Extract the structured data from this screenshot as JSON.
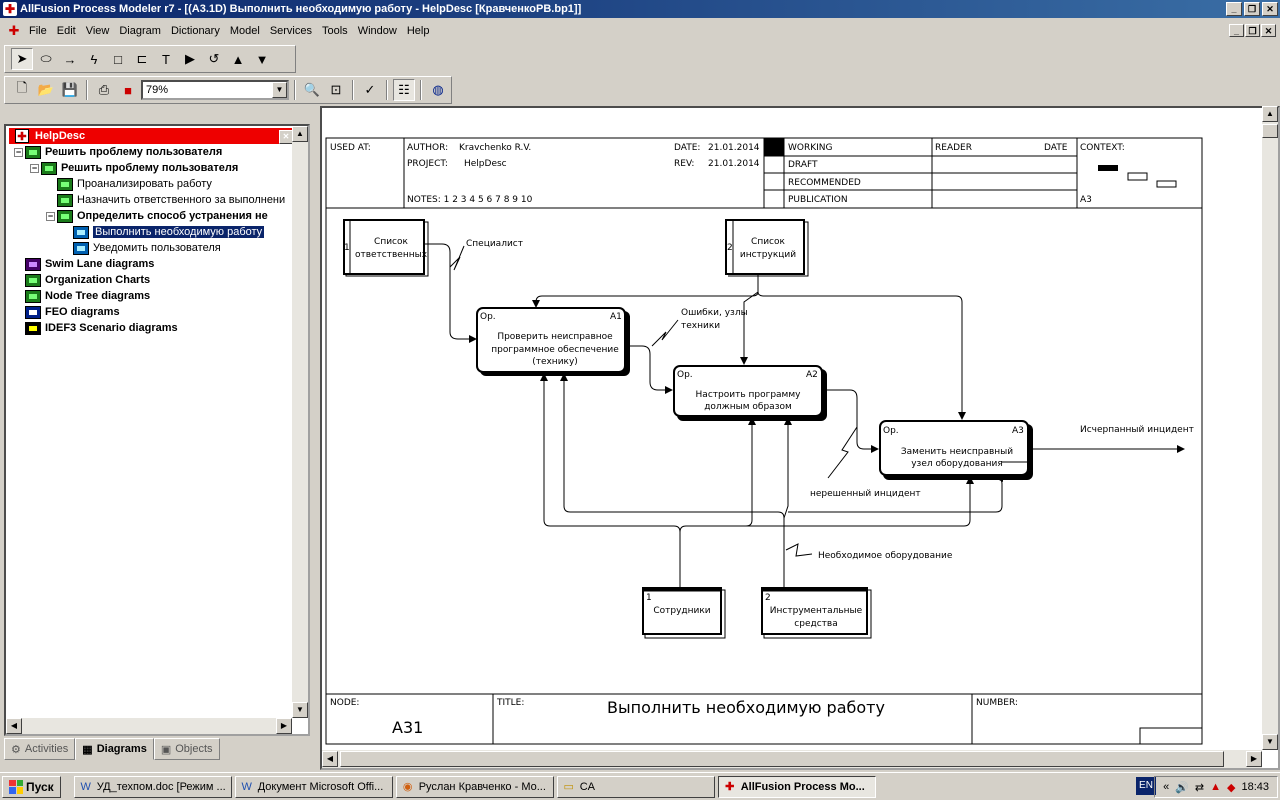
{
  "window": {
    "title": "AllFusion Process Modeler r7 - [(A3.1D) Выполнить необходимую работу - HelpDesc  [КравченкоРВ.bp1]]"
  },
  "menu": [
    "File",
    "Edit",
    "View",
    "Diagram",
    "Dictionary",
    "Model",
    "Services",
    "Tools",
    "Window",
    "Help"
  ],
  "toolbar": {
    "zoom": "79%"
  },
  "tree": {
    "root": "HelpDesc",
    "nodes": [
      {
        "label": "Решить проблему пользователя",
        "level": 0,
        "bold": true,
        "expanded": true,
        "icon": "green"
      },
      {
        "label": "Решить проблему пользователя",
        "level": 1,
        "bold": true,
        "expanded": true,
        "icon": "green"
      },
      {
        "label": "Проанализировать работу",
        "level": 2,
        "bold": false,
        "icon": "green"
      },
      {
        "label": "Назначить ответственного за выполнени",
        "level": 2,
        "bold": false,
        "icon": "green"
      },
      {
        "label": "Определить способ устранения не",
        "level": 2,
        "bold": true,
        "expanded": true,
        "icon": "green"
      },
      {
        "label": "Выполнить необходимую работу",
        "level": 3,
        "bold": false,
        "selected": true,
        "icon": "blue"
      },
      {
        "label": "Уведомить пользователя",
        "level": 3,
        "bold": false,
        "icon": "blue"
      },
      {
        "label": "Swim Lane diagrams",
        "level": 0,
        "bold": true,
        "icon": "swim"
      },
      {
        "label": "Organization Charts",
        "level": 0,
        "bold": true,
        "icon": "green"
      },
      {
        "label": "Node Tree diagrams",
        "level": 0,
        "bold": true,
        "icon": "green"
      },
      {
        "label": "FEO diagrams",
        "level": 0,
        "bold": true,
        "icon": "feo"
      },
      {
        "label": "IDEF3 Scenario diagrams",
        "level": 0,
        "bold": true,
        "icon": "idef3"
      }
    ]
  },
  "tabs": [
    {
      "label": "Activities",
      "active": false
    },
    {
      "label": "Diagrams",
      "active": true
    },
    {
      "label": "Objects",
      "active": false
    }
  ],
  "header": {
    "used_at": "USED AT:",
    "author_label": "AUTHOR:",
    "author": "Kravchenko R.V.",
    "project_label": "PROJECT:",
    "project": "HelpDesc",
    "date_label": "DATE:",
    "date": "21.01.2014",
    "rev_label": "REV:",
    "rev": "21.01.2014",
    "notes": "NOTES:  1  2  3  4  5  6  7  8  9  10",
    "status": [
      "WORKING",
      "DRAFT",
      "RECOMMENDED",
      "PUBLICATION"
    ],
    "reader": "READER",
    "reader_date": "DATE",
    "context": "CONTEXT:",
    "context_node": "A3"
  },
  "footer": {
    "node_label": "NODE:",
    "node": "A31",
    "title_label": "TITLE:",
    "title": "Выполнить необходимую работу",
    "number_label": "NUMBER:"
  },
  "diagram": {
    "activities": [
      {
        "code": "A1",
        "op": "Op.",
        "lines": [
          "Проверить неисправное",
          "программное обеспечение",
          "(технику)"
        ]
      },
      {
        "code": "A2",
        "op": "Op.",
        "lines": [
          "Настроить программу",
          "должным образом"
        ]
      },
      {
        "code": "A3",
        "op": "Op.",
        "lines": [
          "Заменить неисправный",
          "узел оборудования"
        ]
      }
    ],
    "externals": [
      {
        "num": "1",
        "lines": [
          "Список",
          "ответственных"
        ]
      },
      {
        "num": "2",
        "lines": [
          "Список",
          "инструкций"
        ]
      },
      {
        "num": "1",
        "lines": [
          "Сотрудники"
        ]
      },
      {
        "num": "2",
        "lines": [
          "Инструментальные",
          "средства"
        ]
      }
    ],
    "arrow_labels": {
      "specialist": "Специалист",
      "errors": [
        "Ошибки, узлы",
        "техники"
      ],
      "unresolved": "нерешенный инцидент",
      "equipment": "Необходимое оборудование",
      "output": "Исчерпанный инцидент"
    }
  },
  "taskbar": {
    "start": "Пуск",
    "tasks": [
      {
        "label": "УД_техпом.doc [Режим ...",
        "icon": "W",
        "active": false
      },
      {
        "label": "Документ Microsoft Offi...",
        "icon": "W",
        "active": false
      },
      {
        "label": "Руслан Кравченко - Мо...",
        "icon": "◉",
        "active": false
      },
      {
        "label": "CA",
        "icon": "▭",
        "active": false
      },
      {
        "label": "AllFusion Process Mo...",
        "icon": "✚",
        "active": true
      }
    ],
    "lang": "EN",
    "clock": "18:43"
  }
}
